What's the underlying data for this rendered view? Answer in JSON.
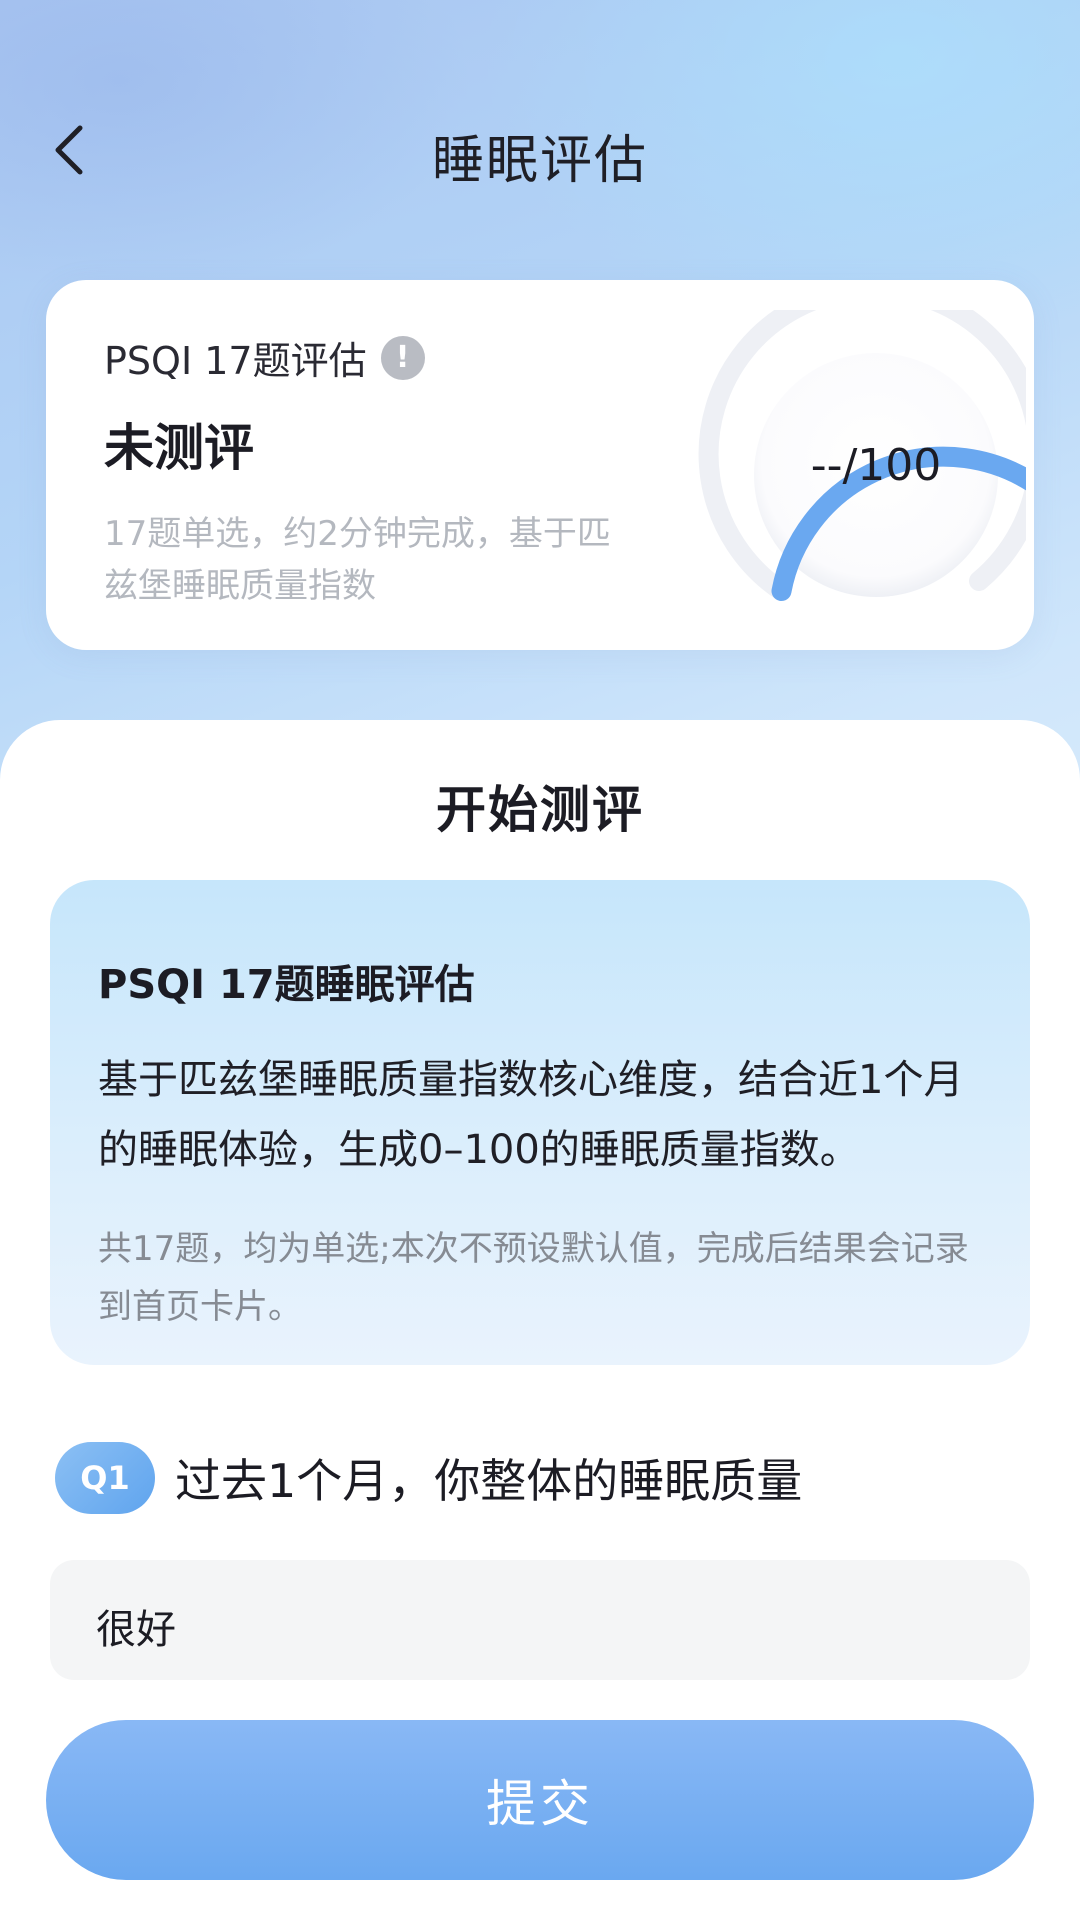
{
  "header": {
    "title": "睡眠评估",
    "back_icon": "chevron-left-icon"
  },
  "score_card": {
    "assessment_name": "PSQI 17题评估",
    "info_icon": "exclamation-circle-icon",
    "status": "未测评",
    "description": "17题单选，约2分钟完成，基于匹兹堡睡眠质量指数",
    "score_display": "--/100",
    "colors": {
      "gauge_arc": "#6aa8f0",
      "gauge_track": "#eef0f5"
    }
  },
  "main": {
    "section_title": "开始测评",
    "intro": {
      "title": "PSQI 17题睡眠评估",
      "body": "基于匹兹堡睡眠质量指数核心维度，结合近1个月的睡眠体验，生成0–100的睡眠质量指数。",
      "note": "共17题，均为单选;本次不预设默认值，完成后结果会记录到首页卡片。"
    },
    "question": {
      "badge": "Q1",
      "text": "过去1个月，你整体的睡眠质量",
      "options": [
        "很好"
      ]
    },
    "submit_label": "提交",
    "colors": {
      "accent": "#6aa8f0"
    }
  }
}
